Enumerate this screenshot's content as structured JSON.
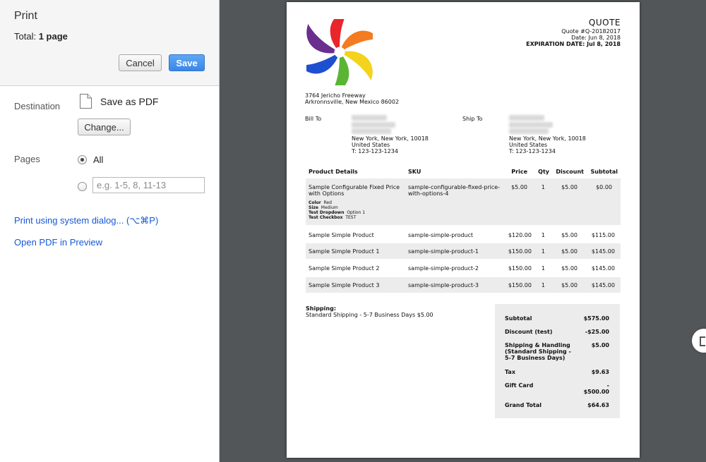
{
  "sidebar": {
    "title": "Print",
    "total_label": "Total:",
    "total_value": "1 page",
    "cancel_label": "Cancel",
    "save_label": "Save",
    "destination_label": "Destination",
    "destination_value": "Save as PDF",
    "change_label": "Change...",
    "pages_label": "Pages",
    "all_label": "All",
    "pages_placeholder": "e.g. 1-5, 8, 11-13",
    "system_dialog_link": "Print using system dialog... (⌥⌘P)",
    "open_pdf_link": "Open PDF in Preview"
  },
  "quote": {
    "title": "QUOTE",
    "number": "Quote #Q-20182017",
    "date": "Date: Jun 8, 2018",
    "expiration": "EXPIRATION DATE: Jul 8, 2018",
    "address_line1": "3764 Jericho Freeway",
    "address_line2": "Arkronnsville, New Mexico 86002",
    "bill_to_label": "Bill To",
    "ship_to_label": "Ship To",
    "bill_to": {
      "city": "New York, New York, 10018",
      "country": "United States",
      "phone": "T: 123-123-1234"
    },
    "ship_to": {
      "city": "New York, New York, 10018",
      "country": "United States",
      "phone": "T: 123-123-1234"
    },
    "columns": [
      "Product Details",
      "SKU",
      "Price",
      "Qty",
      "Discount",
      "Subtotal"
    ],
    "items": [
      {
        "name_line1": "Sample Configurable Fixed Price",
        "name_line2": "with Options",
        "sku_line1": "sample-configurable-fixed-price-",
        "sku_line2": "with-options-4",
        "price": "$5.00",
        "qty": "1",
        "discount": "$5.00",
        "subtotal": "$0.00",
        "options": [
          {
            "label": "Color",
            "value": "Red"
          },
          {
            "label": "Size",
            "value": "Medium"
          },
          {
            "label": "Test Dropdown",
            "value": "Option 1"
          },
          {
            "label": "Test Checkbox",
            "value": "TEST"
          }
        ]
      },
      {
        "name": "Sample Simple Product",
        "sku": "sample-simple-product",
        "price": "$120.00",
        "qty": "1",
        "discount": "$5.00",
        "subtotal": "$115.00"
      },
      {
        "name": "Sample Simple Product 1",
        "sku": "sample-simple-product-1",
        "price": "$150.00",
        "qty": "1",
        "discount": "$5.00",
        "subtotal": "$145.00"
      },
      {
        "name": "Sample Simple Product 2",
        "sku": "sample-simple-product-2",
        "price": "$150.00",
        "qty": "1",
        "discount": "$5.00",
        "subtotal": "$145.00"
      },
      {
        "name": "Sample Simple Product 3",
        "sku": "sample-simple-product-3",
        "price": "$150.00",
        "qty": "1",
        "discount": "$5.00",
        "subtotal": "$145.00"
      }
    ],
    "shipping_label": "Shipping:",
    "shipping_value": "Standard Shipping - 5-7 Business Days $5.00",
    "totals": {
      "subtotal_label": "Subtotal",
      "subtotal_value": "$575.00",
      "discount_label": "Discount (test)",
      "discount_value": "-$25.00",
      "shipping_line1": "Shipping & Handling",
      "shipping_line2": "(Standard Shipping -",
      "shipping_line3": "5-7 Business Days)",
      "shipping_value": "$5.00",
      "tax_label": "Tax",
      "tax_value": "$9.63",
      "giftcard_label": "Gift Card",
      "giftcard_value_line1": "-",
      "giftcard_value_line2": "$500.00",
      "grand_label": "Grand Total",
      "grand_value": "$64.63"
    }
  },
  "colors": {
    "save_button": "#3b86e6",
    "link": "#1558d6",
    "viewer_bg": "#525659"
  },
  "icons": [
    "document-icon",
    "logo-icon",
    "fit-page-icon"
  ]
}
